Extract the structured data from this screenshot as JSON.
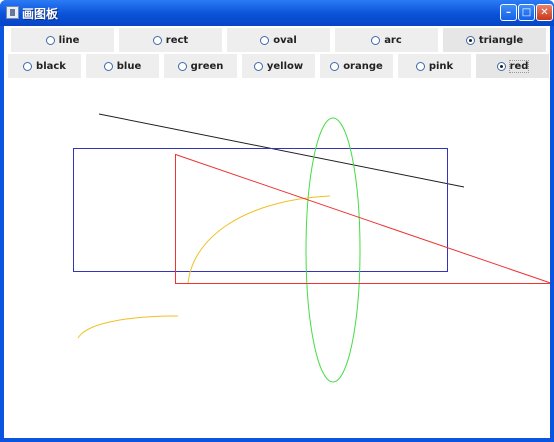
{
  "window": {
    "title": "画图板",
    "minimize_glyph": "–",
    "maximize_glyph": "□",
    "close_glyph": "✕"
  },
  "shapes": {
    "options": [
      {
        "label": "line",
        "selected": false
      },
      {
        "label": "rect",
        "selected": false
      },
      {
        "label": "oval",
        "selected": false
      },
      {
        "label": "arc",
        "selected": false
      },
      {
        "label": "triangle",
        "selected": true
      }
    ]
  },
  "colors": {
    "options": [
      {
        "label": "black",
        "selected": false
      },
      {
        "label": "blue",
        "selected": false
      },
      {
        "label": "green",
        "selected": false
      },
      {
        "label": "yellow",
        "selected": false
      },
      {
        "label": "orange",
        "selected": false
      },
      {
        "label": "pink",
        "selected": false
      },
      {
        "label": "red",
        "selected": true
      }
    ]
  },
  "drawing": {
    "stroke_colors": {
      "black": "#202020",
      "blue": "#3333bb",
      "green": "#44dd44",
      "yellow": "#f0c020",
      "red": "#ee3333"
    }
  }
}
